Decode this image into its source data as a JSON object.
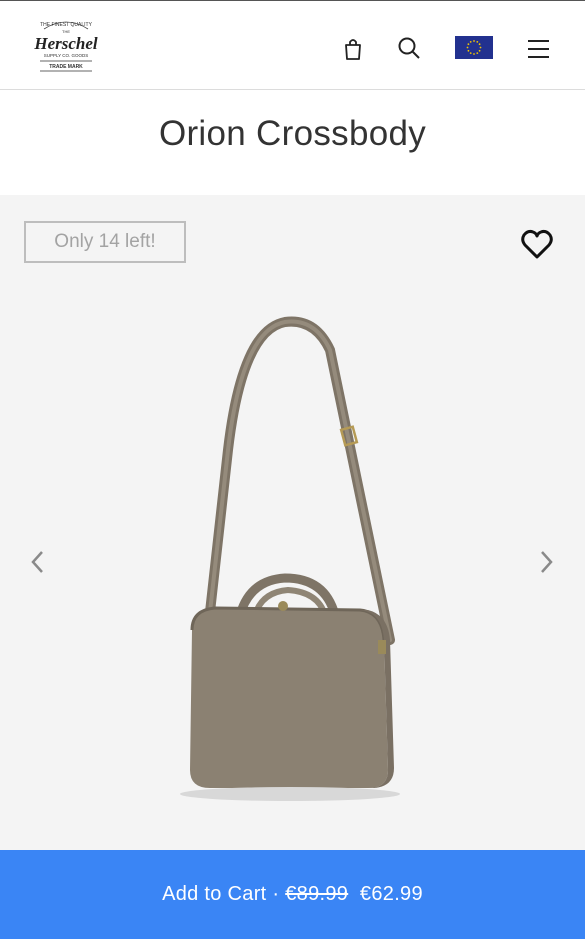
{
  "header": {
    "logo": {
      "icon": "herschel-logo",
      "text_lines": [
        "THE FINEST QUALITY",
        "THE",
        "Herschel",
        "SUPPLY CO. GOODS",
        "TRADE MARK"
      ]
    },
    "nav": [
      {
        "name": "cart",
        "icon": "shopping-bag-icon"
      },
      {
        "name": "search",
        "icon": "search-icon"
      },
      {
        "name": "region",
        "icon": "eu-flag-icon"
      },
      {
        "name": "menu",
        "icon": "hamburger-menu-icon"
      }
    ]
  },
  "product": {
    "title": "Orion Crossbody",
    "stock_badge": "Only 14 left!",
    "image_alt": "product-bag-image"
  },
  "gallery": {
    "prev_icon": "chevron-left-icon",
    "next_icon": "chevron-right-icon",
    "wishlist_icon": "heart-icon"
  },
  "cart": {
    "label": "Add to Cart ·",
    "old_price": "€89.99",
    "price": "€62.99"
  },
  "colors": {
    "cart_bar": "#3a85f5",
    "gallery_bg": "#f4f4f4",
    "flag_blue": "#22318f",
    "flag_stars": "#f2c400",
    "bag": "#8b8172"
  }
}
